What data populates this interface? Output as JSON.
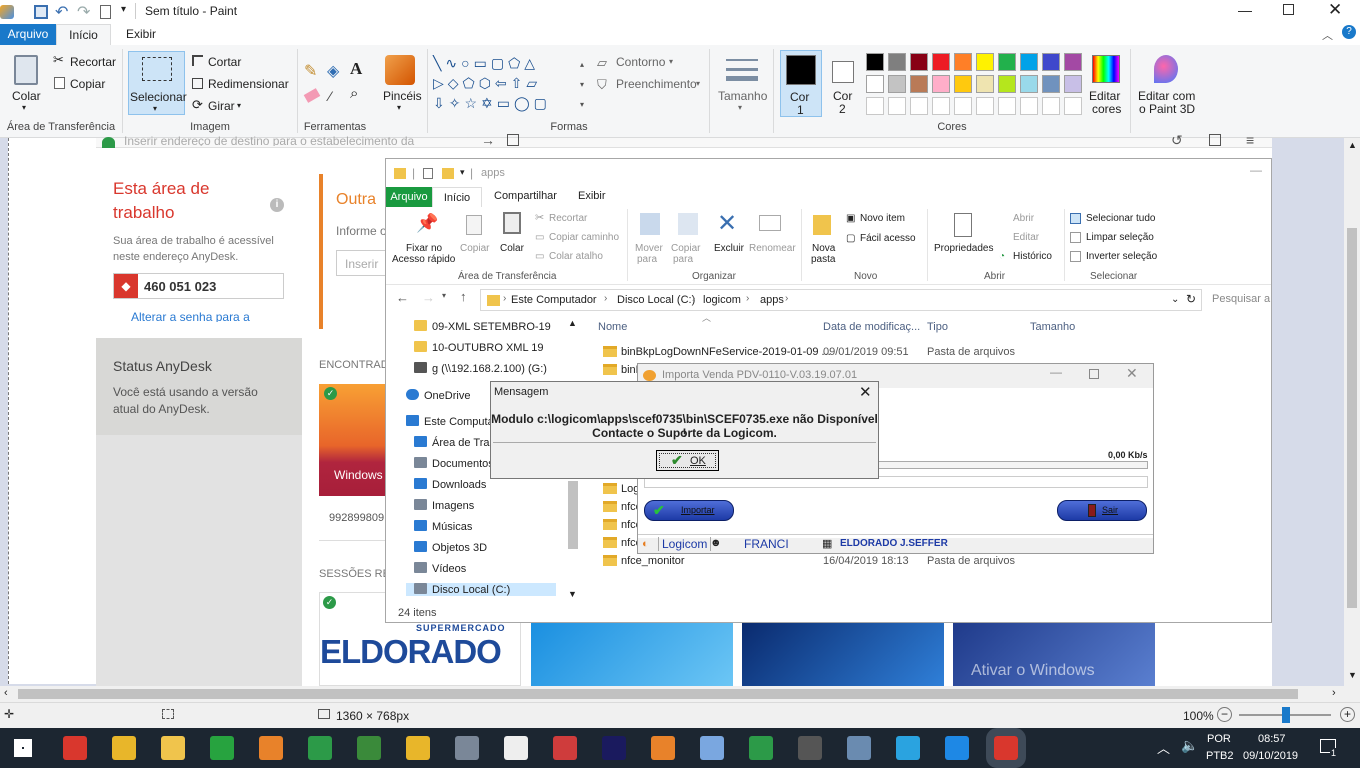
{
  "paint": {
    "title": "Sem título - Paint",
    "tabs": {
      "file": "Arquivo",
      "home": "Início",
      "view": "Exibir"
    },
    "clipboard": {
      "paste": "Colar",
      "cut": "Recortar",
      "copy": "Copiar",
      "label": "Área de Transferência"
    },
    "image": {
      "select": "Selecionar",
      "crop": "Cortar",
      "resize": "Redimensionar",
      "rotate": "Girar",
      "label": "Imagem"
    },
    "tools": {
      "label": "Ferramentas",
      "brushes": "Pincéis"
    },
    "shapes": {
      "outline": "Contorno",
      "fill": "Preenchimento",
      "label": "Formas"
    },
    "size": "Tamanho",
    "color1": "Cor\n1",
    "color1_a": "Cor",
    "color1_b": "1",
    "color2_a": "Cor",
    "color2_b": "2",
    "edit_colors_a": "Editar",
    "edit_colors_b": "cores",
    "paint3d_a": "Editar com",
    "paint3d_b": "o Paint 3D",
    "colors_label": "Cores",
    "palette_row1": [
      "#000000",
      "#7f7f7f",
      "#880015",
      "#ed1c24",
      "#ff7f27",
      "#fff200",
      "#22b14c",
      "#00a2e8",
      "#3f48cc",
      "#a349a4"
    ],
    "palette_row2": [
      "#ffffff",
      "#c3c3c3",
      "#b97a57",
      "#ffaec9",
      "#ffc90e",
      "#efe4b0",
      "#b5e61d",
      "#99d9ea",
      "#7092be",
      "#c8bfe7"
    ],
    "status": {
      "dimensions": "1360 × 768px",
      "zoom": "100%"
    }
  },
  "anydesk": {
    "address_placeholder": "Inserir endereço de destino para o estabelecimento da",
    "workspace_title_1": "Esta área de",
    "workspace_title_2": "trabalho",
    "workspace_desc": "Sua área de trabalho é acessível neste endereço AnyDesk.",
    "address": "460 051 023",
    "change_password": "Alterar a senha para a",
    "status_title": "Status AnyDesk",
    "status_desc": "Você está usando a versão atual do AnyDesk.",
    "other_title": "Outra",
    "other_desc": "Informe o",
    "other_input": "Inserir",
    "found_label": "ENCONTRAD",
    "windows_label": "Windows",
    "remote_id": "992899809",
    "sessions_label": "SESSÕES REC",
    "eldorado_top": "SUPERMERCADO",
    "eldorado_logo": "ELDORADO",
    "activate_windows": "Ativar o Windows"
  },
  "explorer": {
    "title": "apps",
    "tabs": [
      "Arquivo",
      "Início",
      "Compartilhar",
      "Exibir"
    ],
    "ribbon": {
      "pin": "Fixar no\nAcesso rápido",
      "pin_a": "Fixar no",
      "pin_b": "Acesso rápido",
      "copy": "Copiar",
      "paste": "Colar",
      "cut": "Recortar",
      "copy_path": "Copiar caminho",
      "paste_shortcut": "Colar atalho",
      "clipboard_label": "Área de Transferência",
      "move_a": "Mover",
      "move_b": "para",
      "copyto_a": "Copiar",
      "copyto_b": "para",
      "delete": "Excluir",
      "rename": "Renomear",
      "organize_label": "Organizar",
      "newfolder_a": "Nova",
      "newfolder_b": "pasta",
      "new_item": "Novo item",
      "easy_access": "Fácil acesso",
      "new_label": "Novo",
      "properties": "Propriedades",
      "open": "Abrir",
      "edit": "Editar",
      "history": "Histórico",
      "open_label": "Abrir",
      "select_all": "Selecionar tudo",
      "clear_sel": "Limpar seleção",
      "invert_sel": "Inverter seleção",
      "select_label": "Selecionar"
    },
    "breadcrumb": [
      "Este Computador",
      "Disco Local (C:)",
      "logicom",
      "apps"
    ],
    "search_placeholder": "Pesquisar a",
    "nav": [
      "09-XML SETEMBRO-19",
      "10-OUTUBRO XML 19",
      "g (\\\\192.168.2.100) (G:)",
      "OneDrive",
      "Este Computa",
      "Área de Traba",
      "Documentos",
      "Downloads",
      "Imagens",
      "Músicas",
      "Objetos 3D",
      "Vídeos",
      "Disco Local (C:)"
    ],
    "columns": [
      "Nome",
      "Data de modificaç...",
      "Tipo",
      "Tamanho"
    ],
    "files": [
      {
        "name": "binBkpLogDownNFeService-2019-01-09 ...",
        "date": "09/01/2019 09:51",
        "type": "Pasta de arquivos"
      },
      {
        "name": "binB",
        "date": "",
        "type": ""
      },
      {
        "name": "Logi",
        "date": "",
        "type": ""
      },
      {
        "name": "Logi",
        "date": "",
        "type": ""
      },
      {
        "name": "LogS",
        "date": "",
        "type": ""
      },
      {
        "name": "nfce",
        "date": "",
        "type": ""
      },
      {
        "name": "nfce_",
        "date": "",
        "type": ""
      },
      {
        "name": "nfce_exp_venda_ret",
        "date": "23/08/2019 14:14",
        "type": "Pasta de arquivos"
      },
      {
        "name": "nfce_monitor",
        "date": "16/04/2019 18:13",
        "type": "Pasta de arquivos"
      }
    ],
    "item_count": "24 itens"
  },
  "import_window": {
    "title": "Importa Venda PDV-0110-V.03.19.07.01",
    "speed": "0,00 Kb/s",
    "import_btn": "Importar",
    "exit_btn": "Sair",
    "footer_app": "Logicom",
    "footer_user": "FRANCI",
    "footer_company": "ELDORADO J.SEFFER"
  },
  "message": {
    "title": "Mensagem",
    "line1": "Modulo c:\\logicom\\apps\\scef0735\\bin\\SCEF0735.exe não Disponível !",
    "line2": "Contacte o Suporte da Logicom.",
    "ok": "OK"
  },
  "taskbar": {
    "lang": "POR",
    "layout": "PTB2",
    "time": "08:57",
    "date": "09/10/2019",
    "notif_count": "1"
  }
}
